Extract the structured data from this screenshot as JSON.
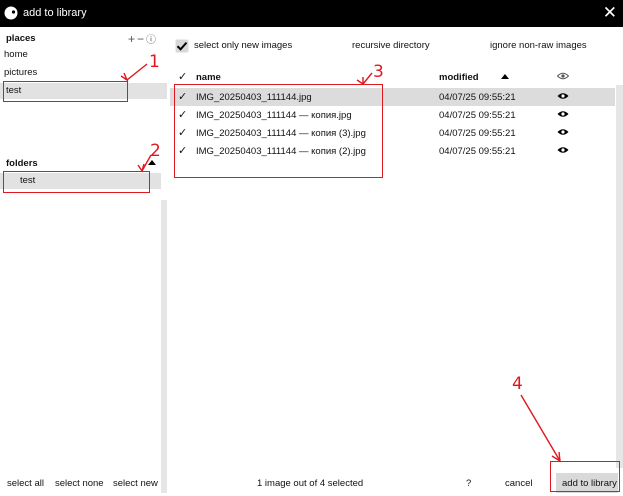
{
  "window": {
    "title": "add to library"
  },
  "places": {
    "header": "places",
    "items": [
      {
        "label": "home"
      },
      {
        "label": "pictures"
      },
      {
        "label": "test"
      }
    ]
  },
  "folders": {
    "header": "folders",
    "items": [
      {
        "label": "test"
      }
    ]
  },
  "options": {
    "select_only_new": {
      "label": "select only new images",
      "checked": true
    },
    "recursive": {
      "label": "recursive directory"
    },
    "ignore_non_raw": {
      "label": "ignore non-raw images"
    }
  },
  "file_list": {
    "columns": {
      "check": "✓",
      "name": "name",
      "modified": "modified"
    },
    "rows": [
      {
        "check": "✓",
        "name": "IMG_20250403_111144.jpg",
        "modified": "04/07/25 09:55:21"
      },
      {
        "check": "✓",
        "name": "IMG_20250403_111144 — копия.jpg",
        "modified": "04/07/25 09:55:21"
      },
      {
        "check": "✓",
        "name": "IMG_20250403_111144 — копия (3).jpg",
        "modified": "04/07/25 09:55:21"
      },
      {
        "check": "✓",
        "name": "IMG_20250403_111144 — копия (2).jpg",
        "modified": "04/07/25 09:55:21"
      }
    ]
  },
  "footer": {
    "select_all": "select all",
    "select_none": "select none",
    "select_new": "select new",
    "status": "1 image out of 4 selected",
    "help": "?",
    "cancel": "cancel",
    "add": "add to library"
  },
  "annotations": [
    "1",
    "2",
    "3",
    "4"
  ],
  "colors": {
    "annotation": "#e0171f",
    "selection": "#dcdcdc",
    "titlebar": "#000000"
  }
}
